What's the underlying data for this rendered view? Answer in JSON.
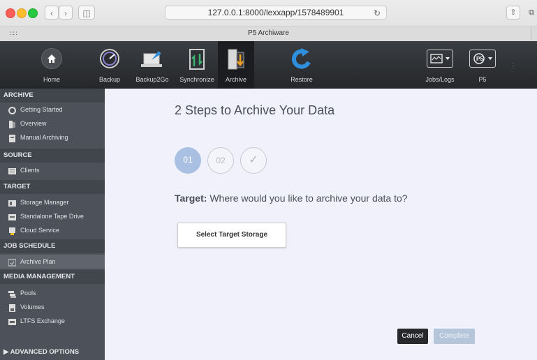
{
  "browser": {
    "url": "127.0.0.1:8000/lexxapp/1578489901",
    "tab_title": "P5   Archiware"
  },
  "toolbar": {
    "items": [
      {
        "label": "Home",
        "icon": "home-icon"
      },
      {
        "label": "Backup",
        "icon": "backup-gauge-icon"
      },
      {
        "label": "Backup2Go",
        "icon": "backup2go-laptop-icon"
      },
      {
        "label": "Synchronize",
        "icon": "synchronize-icon"
      },
      {
        "label": "Archive",
        "icon": "archive-icon"
      },
      {
        "label": "Restore",
        "icon": "restore-arrow-icon"
      },
      {
        "label": "Jobs/Logs",
        "icon": "jobs-logs-icon"
      },
      {
        "label": "P5",
        "icon": "p5-logo-icon"
      }
    ],
    "active": "Archive"
  },
  "sidebar": {
    "archive_header": "ARCHIVE",
    "archive_items": [
      "Getting Started",
      "Overview",
      "Manual Archiving"
    ],
    "source_header": "SOURCE",
    "source_items": [
      "Clients"
    ],
    "target_header": "TARGET",
    "target_items": [
      "Storage Manager",
      "Standalone Tape Drive",
      "Cloud Service"
    ],
    "job_header": "JOB SCHEDULE",
    "job_items": [
      "Archive Plan"
    ],
    "media_header": "MEDIA MANAGEMENT",
    "media_items": [
      "Pools",
      "Volumes",
      "LTFS Exchange"
    ],
    "advanced": "ADVANCED OPTIONS",
    "active_item": "Archive Plan"
  },
  "main": {
    "title": "2 Steps to Archive Your Data",
    "steps": [
      "01",
      "02",
      "✓"
    ],
    "current_step": 1,
    "question_label": "Target:",
    "question_text": "Where would you like to archive your data to?",
    "select_button": "Select Target Storage",
    "cancel_button": "Cancel",
    "complete_button": "Complete"
  },
  "colors": {
    "toolbar_bg": "#2e3034",
    "sidebar_bg": "#4d525a",
    "main_bg": "#f0f1fa",
    "step_active": "#a9c0e3"
  }
}
